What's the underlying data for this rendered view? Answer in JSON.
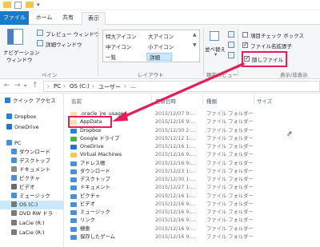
{
  "ribbon_tabs": {
    "file": "ファイル",
    "home": "ホーム",
    "share": "共有",
    "view": "表示"
  },
  "pane_group": {
    "nav_pane_line1": "ナビゲーション",
    "nav_pane_line2": "ウィンドウ",
    "preview_pane": "プレビュー ウィンドウ",
    "details_pane": "詳細ウィンドウ",
    "label": "ペイン"
  },
  "layout_group": {
    "extra_large_icons": "特大アイコン",
    "large_icons": "大アイコン",
    "medium_icons": "中アイコン",
    "small_icons": "小アイコン",
    "list": "一覧",
    "details": "詳細",
    "label": "レイアウト"
  },
  "current_view_group": {
    "sort_by": "並べ替え",
    "label": "現在のビュー"
  },
  "show_hide_group": {
    "item_checkboxes": "項目チェック ボックス",
    "file_extensions": "ファイル名拡張子",
    "hidden_items": "隠しファイル",
    "label": "表示/非表示"
  },
  "address_bar": {
    "crumbs": [
      "PC",
      "OS (C:)",
      "ユーザー",
      "…"
    ]
  },
  "sidebar": {
    "items": [
      {
        "label": "クイック アクセス",
        "icon": "star-icon",
        "color": "#2d7fd3"
      },
      {
        "label": "Dropbox",
        "icon": "dropbox-icon",
        "color": "#2a7fe0"
      },
      {
        "label": "OneDrive",
        "icon": "cloud-icon",
        "color": "#2a6fc9"
      },
      {
        "label": "PC",
        "icon": "computer-icon",
        "color": "#4a90d9"
      },
      {
        "label": "ダウンロード",
        "icon": "download-icon",
        "color": "#4a90d9"
      },
      {
        "label": "デスクトップ",
        "icon": "desktop-icon",
        "color": "#4a90d9"
      },
      {
        "label": "ドキュメント",
        "icon": "document-icon",
        "color": "#8c8c8c"
      },
      {
        "label": "ピクチャ",
        "icon": "picture-icon",
        "color": "#4a90d9"
      },
      {
        "label": "ビデオ",
        "icon": "video-icon",
        "color": "#6b6b6b"
      },
      {
        "label": "ミュージック",
        "icon": "music-icon",
        "color": "#4a90d9"
      },
      {
        "label": "OS (C:)",
        "icon": "drive-icon",
        "color": "#7a7a7a"
      },
      {
        "label": "DVD RW ドラ",
        "icon": "dvd-icon",
        "color": "#7a7a7a"
      },
      {
        "label": "LaCie (R:)",
        "icon": "drive-icon",
        "color": "#7a7a7a"
      },
      {
        "label": "LaCie (R:)",
        "icon": "drive-icon",
        "color": "#7a7a7a"
      }
    ]
  },
  "file_list": {
    "headers": {
      "name": "名前",
      "date": "更新日時",
      "type": "種類",
      "size": "サイズ"
    },
    "rows": [
      {
        "name": ".oracle_jre_usage",
        "date": "2015/12/07 9:…",
        "type": "ファイル フォルダー",
        "icon": "folder-icon"
      },
      {
        "name": "AppData",
        "date": "2015/12/16 9:…",
        "type": "ファイル フォルダー",
        "icon": "folder-icon"
      },
      {
        "name": "Dropbox",
        "date": "2015/12/30 2:…",
        "type": "ファイル フォルダー",
        "icon": "dropbox-icon"
      },
      {
        "name": "Google ドライブ",
        "date": "2015/12/12 1:…",
        "type": "ファイル フォルダー",
        "icon": "google-drive-icon"
      },
      {
        "name": "OneDrive",
        "date": "2015/12/16 1:…",
        "type": "ファイル フォルダー",
        "icon": "cloud-icon"
      },
      {
        "name": "Virtual Machines",
        "date": "2015/12/16 9:…",
        "type": "ファイル フォルダー",
        "icon": "folder-icon"
      },
      {
        "name": "アドレス帳",
        "date": "2015/12/16 9:…",
        "type": "ファイル フォルダー",
        "icon": "contacts-icon"
      },
      {
        "name": "ダウンロード",
        "date": "2015/12/23 1:…",
        "type": "ファイル フォルダー",
        "icon": "download-icon"
      },
      {
        "name": "デスクトップ",
        "date": "2015/12/30 1:…",
        "type": "ファイル フォルダー",
        "icon": "desktop-icon"
      },
      {
        "name": "ドキュメント",
        "date": "2015/12/27 1:…",
        "type": "ファイル フォルダー",
        "icon": "document-icon"
      },
      {
        "name": "ピクチャ",
        "date": "2015/12/16 1:…",
        "type": "ファイル フォルダー",
        "icon": "picture-icon"
      },
      {
        "name": "ビデオ",
        "date": "2015/12/16 9:…",
        "type": "ファイル フォルダー",
        "icon": "video-icon"
      },
      {
        "name": "ミュージック",
        "date": "2015/12/16 9:…",
        "type": "ファイル フォルダー",
        "icon": "music-icon"
      },
      {
        "name": "リンク",
        "date": "2015/12/16 9:…",
        "type": "ファイル フォルダー",
        "icon": "link-icon"
      },
      {
        "name": "検索",
        "date": "2015/12/16 9:…",
        "type": "ファイル フォルダー",
        "icon": "search-icon"
      },
      {
        "name": "保存したゲーム",
        "date": "2015/12/16 9:…",
        "type": "ファイル フォルダー",
        "icon": "game-icon"
      }
    ]
  },
  "colors": {
    "file_tab": "#1979ca",
    "highlight": "#e51e5a",
    "selection": "#cce8ff"
  }
}
